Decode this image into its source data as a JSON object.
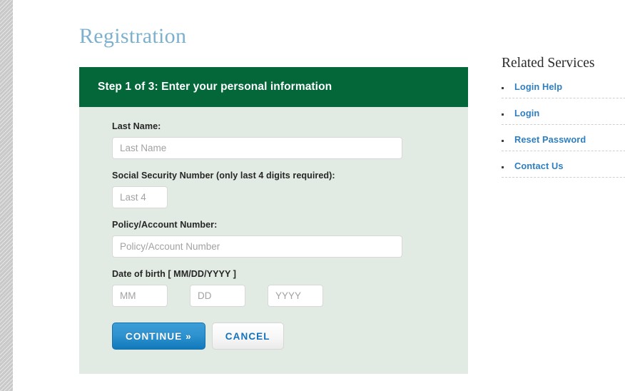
{
  "page": {
    "title": "Registration"
  },
  "form": {
    "step_header": "Step 1 of 3: Enter your personal information",
    "fields": [
      {
        "label": "Last Name:",
        "placeholder": "Last Name",
        "value": "",
        "size": "wide"
      },
      {
        "label": "Social Security Number (only last 4 digits required):",
        "placeholder": "Last 4",
        "value": "",
        "size": "short"
      },
      {
        "label": "Policy/Account Number:",
        "placeholder": "Policy/Account Number",
        "value": "",
        "size": "wide"
      }
    ],
    "dob": {
      "label": "Date of birth [ MM/DD/YYYY ]",
      "month_placeholder": "MM",
      "day_placeholder": "DD",
      "year_placeholder": "YYYY",
      "month_value": "",
      "day_value": "",
      "year_value": ""
    },
    "buttons": {
      "continue_label": "CONTINUE »",
      "cancel_label": "CANCEL"
    }
  },
  "sidebar": {
    "title": "Related Services",
    "links": [
      {
        "label": "Login Help"
      },
      {
        "label": "Login"
      },
      {
        "label": "Reset Password"
      },
      {
        "label": "Contact Us"
      }
    ]
  },
  "colors": {
    "step_header_bg": "#04673a",
    "panel_bg": "#e2ebe3",
    "title_blue": "#7cb0cd",
    "link_blue": "#2d7fc1",
    "continue_blue": "#2f93d0"
  }
}
